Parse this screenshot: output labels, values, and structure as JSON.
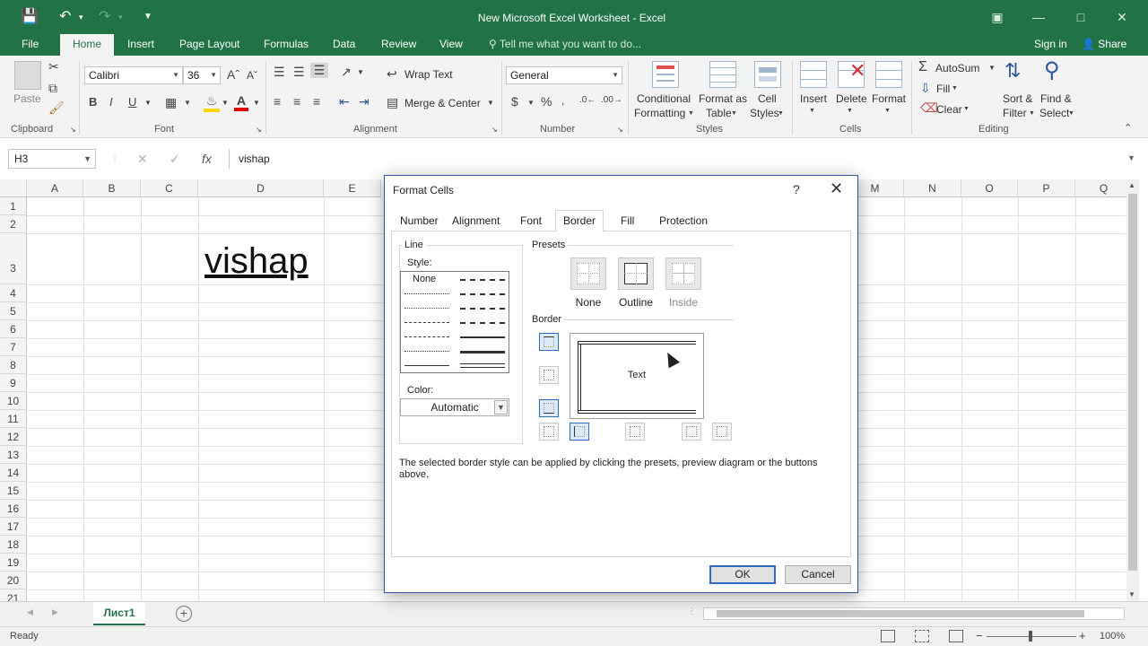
{
  "titlebar": {
    "title": "New Microsoft Excel Worksheet - Excel"
  },
  "tabs": [
    "File",
    "Home",
    "Insert",
    "Page Layout",
    "Formulas",
    "Data",
    "Review",
    "View"
  ],
  "tellme": "Tell me what you want to do...",
  "signin": "Sign in",
  "share": "Share",
  "ribbon": {
    "groups": [
      "Clipboard",
      "Font",
      "Alignment",
      "Number",
      "Styles",
      "Cells",
      "Editing"
    ],
    "paste": "Paste",
    "font_name": "Calibri",
    "font_size": "36",
    "wrap_text": "Wrap Text",
    "merge_center": "Merge & Center",
    "number_format": "General",
    "conditional_1": "Conditional",
    "conditional_2": "Formatting",
    "format_table_1": "Format as",
    "format_table_2": "Table",
    "cell_styles_1": "Cell",
    "cell_styles_2": "Styles",
    "insert": "Insert",
    "delete": "Delete",
    "format": "Format",
    "autosum": "AutoSum",
    "fill": "Fill",
    "clear": "Clear",
    "sort_1": "Sort &",
    "sort_2": "Filter",
    "find_1": "Find &",
    "find_2": "Select"
  },
  "formula_bar": {
    "name_box": "H3",
    "value": "vishap"
  },
  "columns": [
    "A",
    "B",
    "C",
    "D",
    "E",
    "M",
    "N",
    "O",
    "P",
    "Q"
  ],
  "rows": [
    "1",
    "2",
    "3",
    "4",
    "5",
    "6",
    "7",
    "8",
    "9",
    "10",
    "11",
    "12",
    "13",
    "14",
    "15",
    "16",
    "17",
    "18",
    "19",
    "20",
    "21"
  ],
  "cell_h3": "vishap",
  "sheet_tab": "Лист1",
  "status": {
    "ready": "Ready",
    "zoom": "100%"
  },
  "dialog": {
    "title": "Format Cells",
    "help": "?",
    "tabs": [
      "Number",
      "Alignment",
      "Font",
      "Border",
      "Fill",
      "Protection"
    ],
    "line_label": "Line",
    "style_label": "Style:",
    "style_none": "None",
    "color_label": "Color:",
    "color_value": "Automatic",
    "presets_label": "Presets",
    "presets": [
      "None",
      "Outline",
      "Inside"
    ],
    "border_label": "Border",
    "preview_text": "Text",
    "help_text": "The selected border style can be applied by clicking the presets, preview diagram or the buttons above.",
    "ok": "OK",
    "cancel": "Cancel"
  }
}
